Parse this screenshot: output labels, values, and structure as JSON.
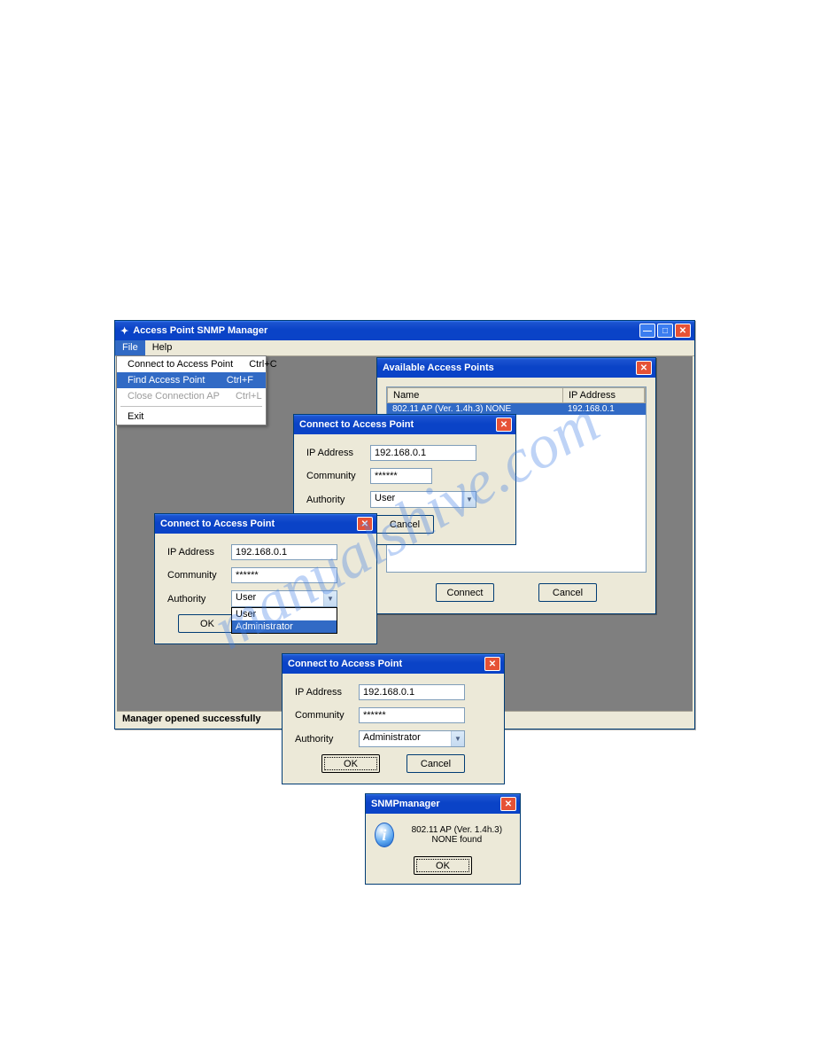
{
  "mainWindow": {
    "title": "Access Point SNMP Manager",
    "menus": {
      "file": "File",
      "help": "Help"
    },
    "status": "Manager opened successfully"
  },
  "fileMenu": {
    "items": [
      {
        "label": "Connect to Access Point",
        "accel": "Ctrl+C",
        "state": "normal"
      },
      {
        "label": "Find Access Point",
        "accel": "Ctrl+F",
        "state": "highlight"
      },
      {
        "label": "Close Connection AP",
        "accel": "Ctrl+L",
        "state": "disabled"
      }
    ],
    "exit": "Exit"
  },
  "availableAP": {
    "title": "Available Access Points",
    "cols": {
      "name": "Name",
      "ip": "IP Address"
    },
    "row": {
      "name": "802.11 AP (Ver. 1.4h.3) NONE",
      "ip": "192.168.0.1"
    },
    "buttons": {
      "connect": "Connect",
      "cancel": "Cancel"
    }
  },
  "connectDlg": {
    "title": "Connect to Access Point",
    "labels": {
      "ip": "IP Address",
      "community": "Community",
      "authority": "Authority"
    },
    "values": {
      "ip": "192.168.0.1",
      "community": "******"
    },
    "authority": {
      "user": "User",
      "admin": "Administrator"
    },
    "buttons": {
      "ok": "OK",
      "cancel": "Cancel"
    }
  },
  "snmpMsg": {
    "title": "SNMPmanager",
    "text": "802.11 AP (Ver. 1.4h.3) NONE found",
    "ok": "OK"
  },
  "watermark": "manualshive.com"
}
